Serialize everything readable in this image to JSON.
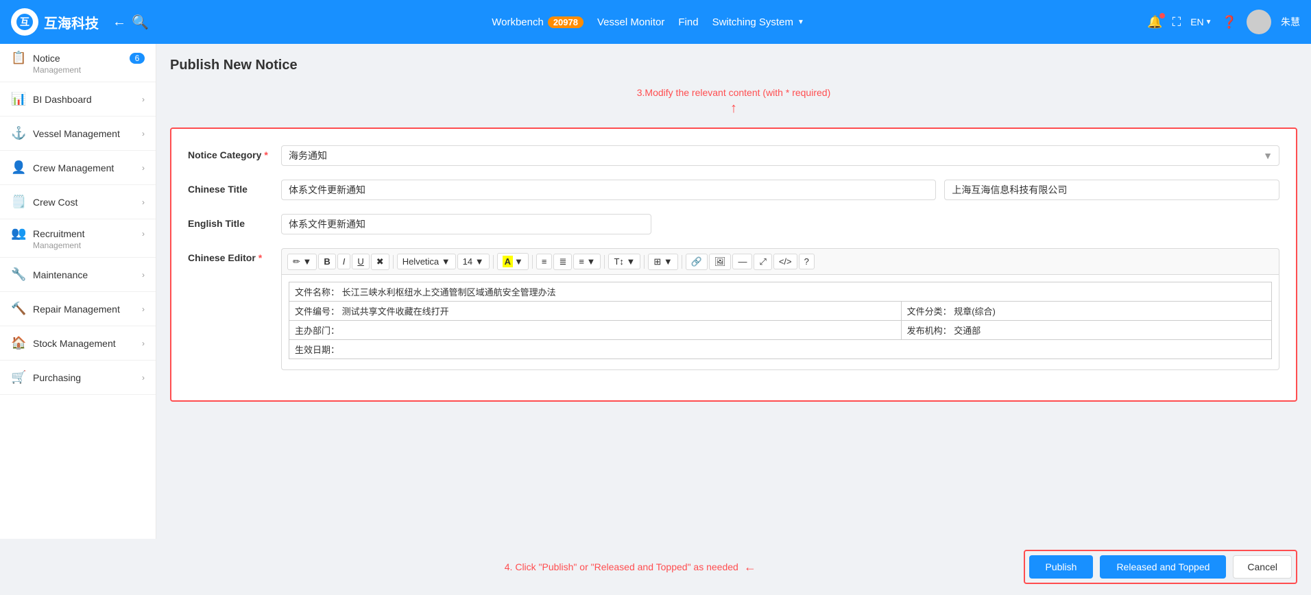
{
  "header": {
    "logo_text": "互海科技",
    "back_icon": "←",
    "search_icon": "🔍",
    "workbench_label": "Workbench",
    "workbench_count": "20978",
    "vessel_monitor": "Vessel Monitor",
    "find": "Find",
    "switching_system": "Switching System",
    "lang": "EN",
    "user_name": "朱慧"
  },
  "sidebar": {
    "items": [
      {
        "id": "notice",
        "icon": "📋",
        "label": "Notice",
        "sub": "Management",
        "badge": "6",
        "active": true
      },
      {
        "id": "bi-dashboard",
        "icon": "📊",
        "label": "BI Dashboard",
        "arrow": "›"
      },
      {
        "id": "vessel-management",
        "icon": "⚓",
        "label": "Vessel Management",
        "arrow": "›"
      },
      {
        "id": "crew-management",
        "icon": "👤",
        "label": "Crew Management",
        "arrow": "›"
      },
      {
        "id": "crew-cost",
        "icon": "🗒️",
        "label": "Crew Cost",
        "arrow": "›"
      },
      {
        "id": "recruitment",
        "icon": "👥",
        "label": "Recruitment",
        "sub": "Management",
        "arrow": "›"
      },
      {
        "id": "maintenance",
        "icon": "🔧",
        "label": "Maintenance",
        "arrow": "›"
      },
      {
        "id": "repair-management",
        "icon": "🔨",
        "label": "Repair Management",
        "arrow": "›"
      },
      {
        "id": "stock-management",
        "icon": "🏠",
        "label": "Stock Management",
        "arrow": "›"
      },
      {
        "id": "purchasing",
        "icon": "🛒",
        "label": "Purchasing",
        "arrow": "›"
      }
    ]
  },
  "main": {
    "page_title": "Publish New Notice",
    "hint3": "3.Modify the relevant content (with * required)",
    "hint4": "4. Click \"Publish\" or \"Released and Topped\" as needed",
    "form": {
      "notice_category_label": "Notice Category",
      "notice_category_value": "海务通知",
      "chinese_title_label": "Chinese Title",
      "chinese_title_value": "体系文件更新通知",
      "chinese_title_company": "上海互海信息科技有限公司",
      "english_title_label": "English Title",
      "english_title_value": "体系文件更新通知",
      "chinese_editor_label": "Chinese Editor",
      "editor_content": {
        "row1_label": "文件名称：",
        "row1_value": "长江三峡水利枢纽水上交通管制区域通航安全管理办法",
        "row2_label": "文件编号：",
        "row2_value": "测试共享文件收藏在线打开",
        "row2_extra_label": "文件分类：",
        "row2_extra_value": "规章(综合)",
        "row3_label": "主办部门：",
        "row3_value": "",
        "row3_extra_label": "发布机构：",
        "row3_extra_value": "交通部",
        "row4_label": "生效日期：",
        "row4_value": ""
      },
      "toolbar": {
        "pen": "✏",
        "bold": "B",
        "italic": "I",
        "underline": "U",
        "clear": "✖",
        "font": "Helvetica",
        "size": "14",
        "color_a": "A",
        "list_ul": "≡",
        "list_ol": "≣",
        "align": "≡",
        "heading": "T↕",
        "table": "⊞",
        "link": "🔗",
        "image": "🖼",
        "hr": "—",
        "fullscreen": "⤢",
        "code": "</>",
        "help": "?"
      }
    },
    "buttons": {
      "publish": "Publish",
      "released_and_topped": "Released and Topped",
      "cancel": "Cancel"
    }
  }
}
